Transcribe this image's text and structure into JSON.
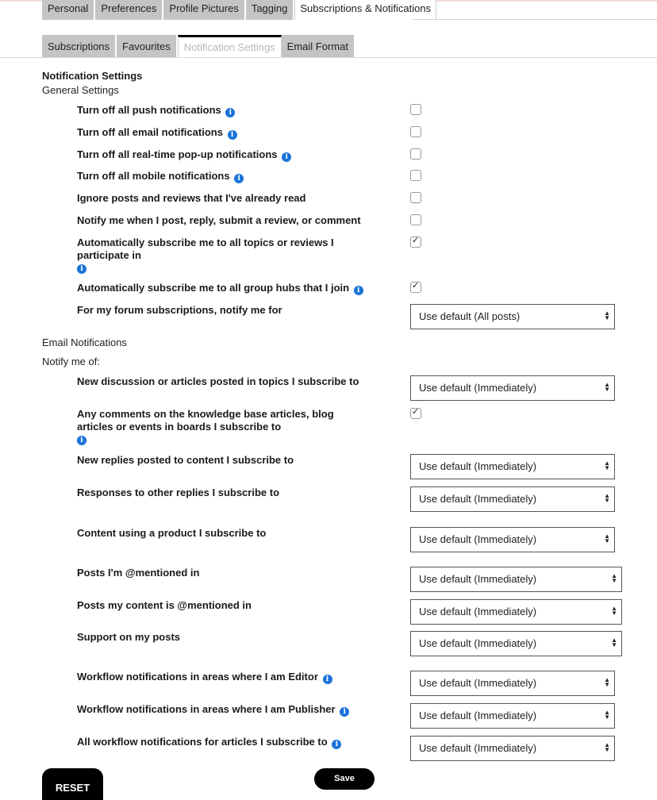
{
  "primary_tabs": [
    {
      "label": "Personal",
      "active": false
    },
    {
      "label": "Preferences",
      "active": false
    },
    {
      "label": "Profile Pictures",
      "active": false
    },
    {
      "label": "Tagging",
      "active": false
    },
    {
      "label": "Subscriptions & Notifications",
      "active": true
    }
  ],
  "secondary_tabs": [
    {
      "label": "Subscriptions",
      "active": false
    },
    {
      "label": "Favourites",
      "active": false
    },
    {
      "label": "Notification Settings",
      "active": true
    },
    {
      "label": "Email Format",
      "active": false
    }
  ],
  "page_title": "Notification Settings",
  "general": {
    "heading": "General Settings",
    "items": [
      {
        "label": "Turn off all push notifications",
        "info": true,
        "checked": false
      },
      {
        "label": "Turn off all email notifications",
        "info": true,
        "checked": false
      },
      {
        "label": "Turn off all real-time pop-up notifications",
        "info": true,
        "checked": false
      },
      {
        "label": "Turn off all mobile notifications",
        "info": true,
        "checked": false
      },
      {
        "label": "Ignore posts and reviews that I've already read",
        "info": false,
        "checked": false
      },
      {
        "label": "Notify me when I post, reply, submit a review, or comment",
        "info": false,
        "checked": false
      },
      {
        "label": "Automatically subscribe me to all topics or reviews I participate in",
        "info": true,
        "checked": true
      },
      {
        "label": "Automatically subscribe me to all group hubs that I join",
        "info": true,
        "checked": true
      }
    ],
    "forum": {
      "label": "For my forum subscriptions, notify me for",
      "value": "Use default (All posts)"
    }
  },
  "email": {
    "heading": "Email Notifications",
    "subheading": "Notify me of:",
    "items": [
      {
        "label": "New discussion or articles posted in topics I subscribe to",
        "type": "select",
        "value": "Use default (Immediately)"
      },
      {
        "label": "Any comments on the knowledge base articles, blog articles or events in boards I subscribe to",
        "type": "checkbox",
        "checked": true,
        "info": true
      },
      {
        "label": "New replies posted to content I subscribe to",
        "type": "select",
        "value": "Use default (Immediately)"
      },
      {
        "label": "Responses to other replies I subscribe to",
        "type": "select",
        "value": "Use default (Immediately)"
      },
      {
        "label": "Content using a product I subscribe to",
        "type": "select",
        "value": "Use default (Immediately)"
      },
      {
        "label": "Posts I'm @mentioned in",
        "type": "select",
        "value": "Use default (Immediately)"
      },
      {
        "label": "Posts my content is @mentioned in",
        "type": "select",
        "value": "Use default (Immediately)"
      },
      {
        "label": "Support on my posts",
        "type": "select",
        "value": "Use default (Immediately)"
      },
      {
        "label": "Workflow notifications in areas where I am Editor",
        "type": "select",
        "value": "Use default (Immediately)",
        "info": true
      },
      {
        "label": "Workflow notifications in areas where I am Publisher",
        "type": "select",
        "value": "Use default (Immediately)",
        "info": true
      },
      {
        "label": "All workflow notifications for articles I subscribe to",
        "type": "select",
        "value": "Use default (Immediately)",
        "info": true
      }
    ]
  },
  "buttons": {
    "reset": "RESET",
    "save": "Save"
  },
  "icons": {
    "info": "i",
    "check": "✓",
    "select_arrows": "▲▼"
  },
  "colors": {
    "info_blue": "#1a73d9",
    "tab_gray": "#c4c4c4",
    "button_black": "#000000"
  }
}
